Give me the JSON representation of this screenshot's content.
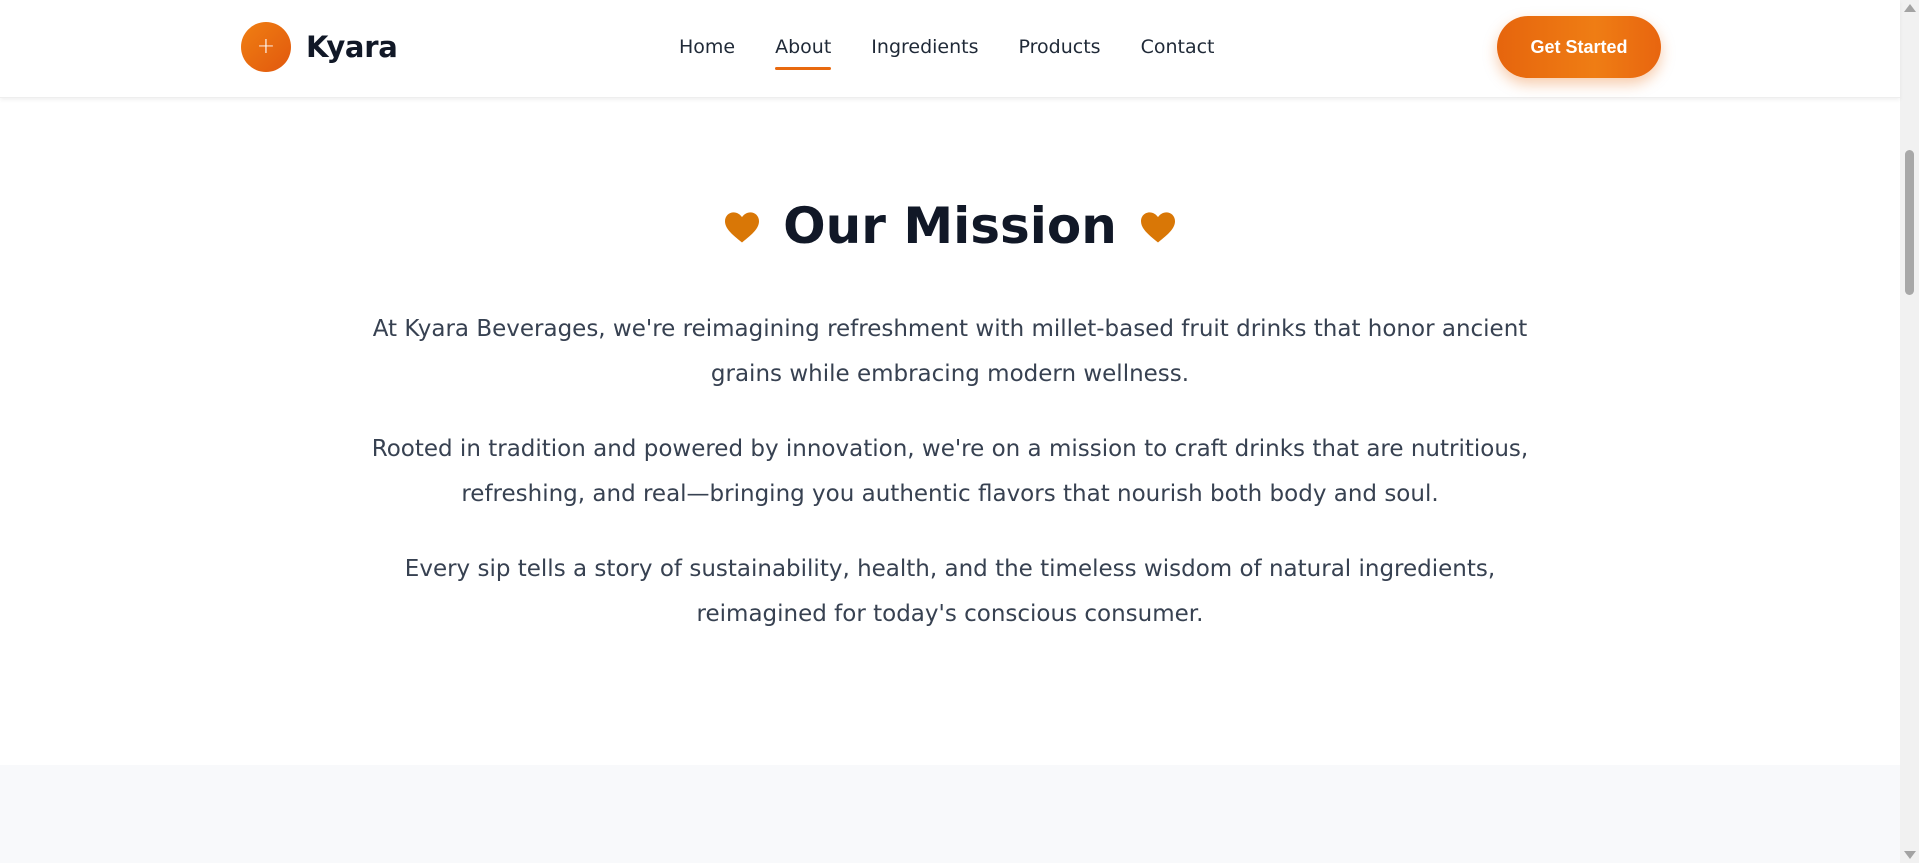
{
  "header": {
    "logo_mark": "+",
    "brand": "Kyara",
    "nav": [
      {
        "label": "Home",
        "active": false
      },
      {
        "label": "About",
        "active": true
      },
      {
        "label": "Ingredients",
        "active": false
      },
      {
        "label": "Products",
        "active": false
      },
      {
        "label": "Contact",
        "active": false
      }
    ],
    "cta_label": "Get Started"
  },
  "mission": {
    "title": "Our Mission",
    "icon": "heart-icon",
    "paragraphs": [
      "At Kyara Beverages, we're reimagining refreshment with millet-based fruit drinks that honor ancient grains while embracing modern wellness.",
      "Rooted in tradition and powered by innovation, we're on a mission to craft drinks that are nutritious, refreshing, and real—bringing you authentic flavors that nourish both body and soul.",
      "Every sip tells a story of sustainability, health, and the timeless wisdom of natural ingredients, reimagined for today's conscious consumer."
    ]
  },
  "colors": {
    "accent": "#e8690f",
    "heart": "#d97706",
    "heading": "#111827",
    "body_text": "#374151",
    "section_alt_bg": "#f8f9fb"
  }
}
